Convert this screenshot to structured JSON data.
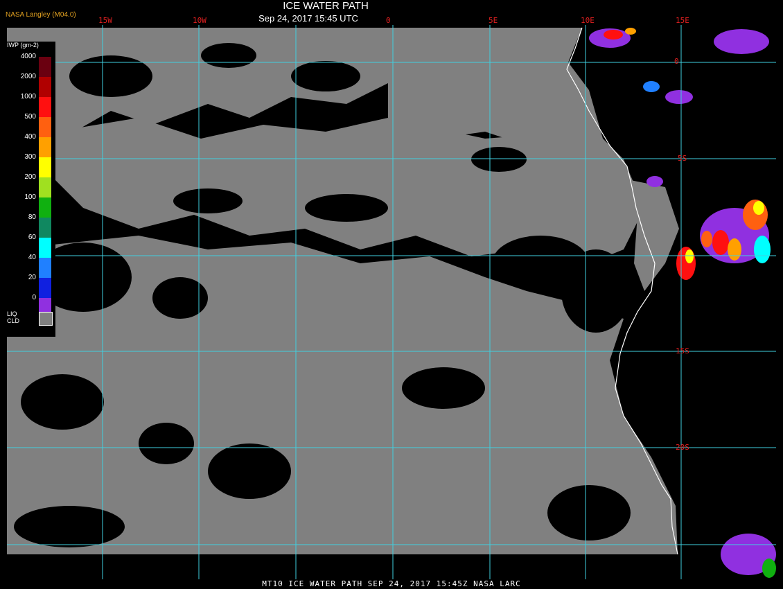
{
  "header": {
    "title": "ICE WATER PATH",
    "subtitle": "Sep 24, 2017 15:45 UTC",
    "credit": "NASA Langley (M04.0)"
  },
  "footer": {
    "text": "MT10  ICE WATER PATH   SEP 24, 2017 15:45Z   NASA LARC"
  },
  "legend": {
    "unit": "IWP (gm-2)",
    "ticks": [
      "4000",
      "2000",
      "1000",
      "500",
      "400",
      "300",
      "200",
      "100",
      "80",
      "60",
      "40",
      "20",
      "0"
    ],
    "colors": [
      "#6a0010",
      "#b00000",
      "#ff1010",
      "#ff6010",
      "#ffa000",
      "#ffff00",
      "#a0e020",
      "#10b010",
      "#108860",
      "#00ffff",
      "#2080ff",
      "#1020e0",
      "#9030e0"
    ],
    "liq_label_1": "LIQ",
    "liq_label_2": "CLD",
    "liq_color": "#808080"
  },
  "grid": {
    "lon_labels": [
      "15W",
      "10W",
      "0",
      "5E",
      "10E",
      "15E"
    ],
    "lat_labels": [
      "0",
      "5S",
      "15S",
      "20S"
    ],
    "line_color": "#40d0e0"
  },
  "map_colors": {
    "cloud_liquid": "#808080",
    "clear": "#000000",
    "coastline": "#ffffff"
  }
}
